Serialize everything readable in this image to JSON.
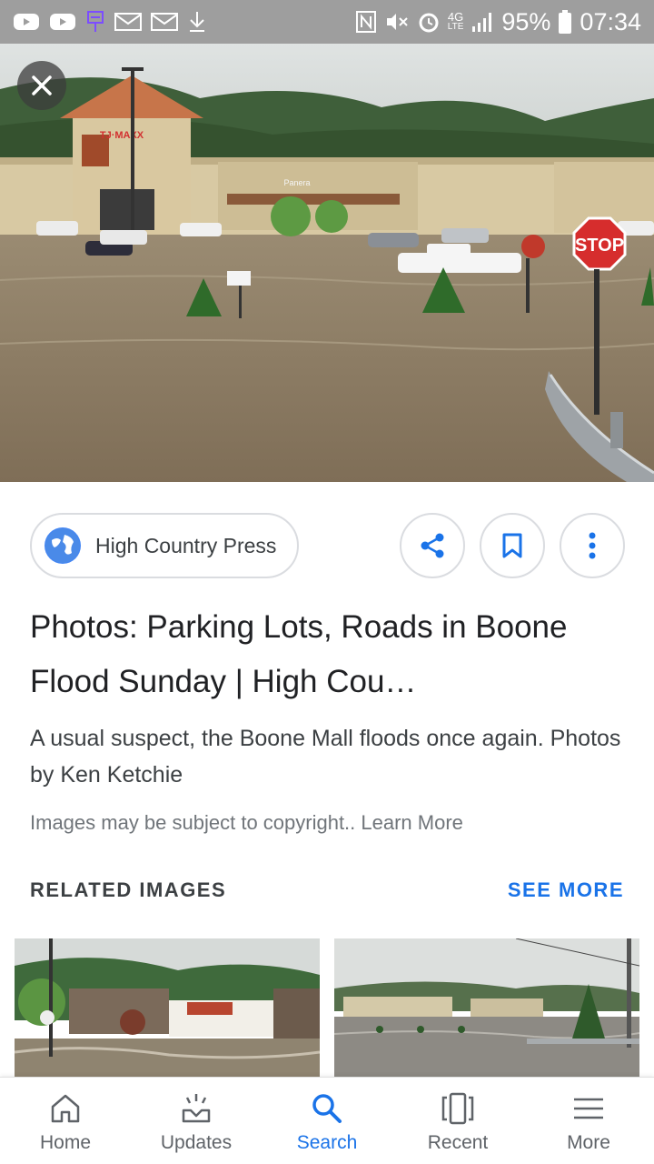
{
  "status_bar": {
    "battery": "95%",
    "time": "07:34",
    "network": "4G",
    "network_sub": "LTE"
  },
  "hero": {
    "store_sign_left": "TJ·MAXX",
    "store_sign_center": "Panera",
    "stop_sign": "STOP"
  },
  "result": {
    "source_name": "High Country Press",
    "title": "Photos: Parking Lots, Roads in Boone Flood Sunday | High Cou…",
    "description": "A usual suspect, the Boone Mall floods once again. Photos by Ken Ketchie",
    "copyright": "Images may be subject to copyright.. Learn More"
  },
  "related": {
    "label": "RELATED IMAGES",
    "see_more": "SEE MORE"
  },
  "nav": {
    "items": [
      {
        "label": "Home",
        "icon": "home-icon"
      },
      {
        "label": "Updates",
        "icon": "updates-icon"
      },
      {
        "label": "Search",
        "icon": "search-icon"
      },
      {
        "label": "Recent",
        "icon": "recent-icon"
      },
      {
        "label": "More",
        "icon": "menu-icon"
      }
    ],
    "active": "Search"
  },
  "colors": {
    "accent": "#1a73e8",
    "status_bar": "#9e9e9e",
    "flood_water": "#8e7e66"
  }
}
